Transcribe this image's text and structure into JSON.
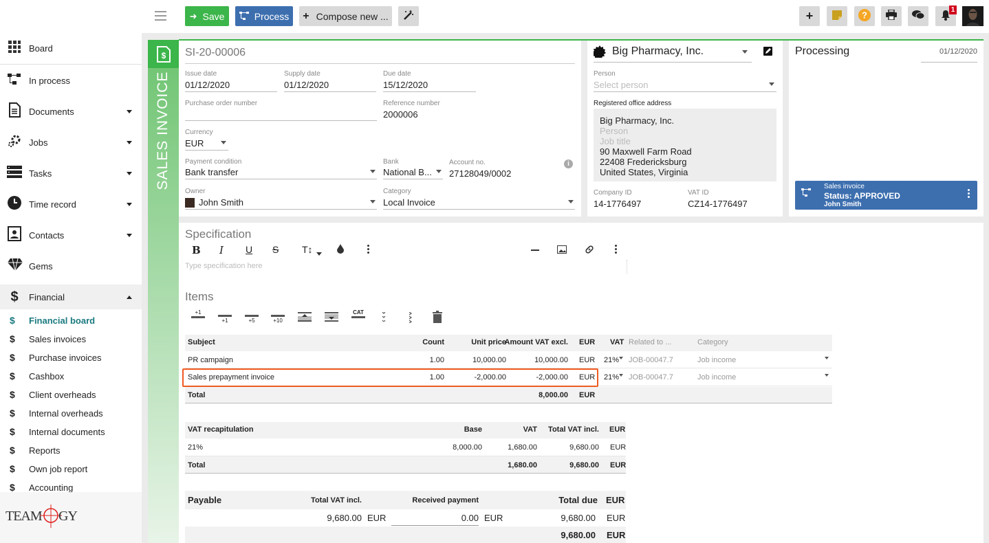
{
  "toolbar": {
    "save_label": "Save",
    "process_label": "Process",
    "compose_label": "Compose new ...",
    "notification_count": "1"
  },
  "sidebar": {
    "items": [
      {
        "label": "Board",
        "icon": "grid-icon"
      },
      {
        "label": "In process",
        "icon": "process-icon"
      },
      {
        "label": "Documents",
        "icon": "document-icon"
      },
      {
        "label": "Jobs",
        "icon": "jobs-icon"
      },
      {
        "label": "Tasks",
        "icon": "tasks-icon"
      },
      {
        "label": "Time record",
        "icon": "clock-icon"
      },
      {
        "label": "Contacts",
        "icon": "contacts-icon"
      },
      {
        "label": "Gems",
        "icon": "gem-icon"
      },
      {
        "label": "Financial",
        "icon": "dollar-icon"
      }
    ],
    "financial_sub": [
      {
        "label": "Financial board"
      },
      {
        "label": "Sales invoices"
      },
      {
        "label": "Purchase invoices"
      },
      {
        "label": "Cashbox"
      },
      {
        "label": "Client overheads"
      },
      {
        "label": "Internal overheads"
      },
      {
        "label": "Internal documents"
      },
      {
        "label": "Reports"
      },
      {
        "label": "Own job report"
      },
      {
        "label": "Accounting"
      }
    ],
    "logo_text": "TEAMOGY"
  },
  "invoice": {
    "type_label": "SALES INVOICE",
    "number": "SI-20-00006",
    "issue_date_label": "Issue date",
    "issue_date": "01/12/2020",
    "supply_date_label": "Supply date",
    "supply_date": "01/12/2020",
    "due_date_label": "Due date",
    "due_date": "15/12/2020",
    "po_label": "Purchase order number",
    "po_value": "",
    "ref_label": "Reference number",
    "ref_value": "2000006",
    "currency_label": "Currency",
    "currency": "EUR",
    "payment_label": "Payment condition",
    "payment": "Bank transfer",
    "bank_label": "Bank",
    "bank": "National B...",
    "account_label": "Account no.",
    "account": "27128049/0002",
    "owner_label": "Owner",
    "owner": "John Smith",
    "category_label": "Category",
    "category": "Local Invoice"
  },
  "client": {
    "name": "Big Pharmacy, Inc.",
    "person_label": "Person",
    "person_placeholder": "Select person",
    "address_label": "Registered office address",
    "address_name": "Big Pharmacy, Inc.",
    "address_person": "Person",
    "address_job": "Job title",
    "address_street": "90 Maxwell Farm Road",
    "address_city": "22408 Fredericksburg",
    "address_country": "United States, Virginia",
    "company_id_label": "Company ID",
    "company_id": "14-1776497",
    "vat_id_label": "VAT ID",
    "vat_id": "CZ14-1776497"
  },
  "processing": {
    "title": "Processing",
    "date": "01/12/2020",
    "card_type": "Sales invoice",
    "card_status": "Status: APPROVED",
    "card_user": "John Smith",
    "card_color": "#3d6faf"
  },
  "spec": {
    "title": "Specification",
    "placeholder": "Type specification here"
  },
  "items": {
    "title": "Items",
    "toolbar": {
      "add1": "+1",
      "add1b": "+1",
      "add5": "+5",
      "add10": "+10",
      "cat": "CAT"
    },
    "headers": {
      "subject": "Subject",
      "count": "Count",
      "unit_price": "Unit price",
      "amount": "Amount VAT excl.",
      "cur": "EUR",
      "vat": "VAT",
      "related": "Related to ...",
      "category": "Category"
    },
    "rows": [
      {
        "subject": "PR campaign",
        "count": "1.00",
        "unit_price": "10,000.00",
        "amount": "10,000.00",
        "cur": "EUR",
        "vat": "21%",
        "related": "JOB-00047.7",
        "category": "Job income"
      },
      {
        "subject": "Sales prepayment invoice",
        "count": "1.00",
        "unit_price": "-2,000.00",
        "amount": "-2,000.00",
        "cur": "EUR",
        "vat": "21%",
        "related": "JOB-00047.7",
        "category": "Job income"
      }
    ],
    "total_label": "Total",
    "total_amount": "8,000.00",
    "total_cur": "EUR",
    "highlight_color": "#f05a22"
  },
  "vat": {
    "headers": {
      "label": "VAT recapitulation",
      "base": "Base",
      "vat": "VAT",
      "total": "Total VAT incl.",
      "cur": "EUR"
    },
    "row": {
      "rate": "21%",
      "base": "8,000.00",
      "vat": "1,680.00",
      "total": "9,680.00",
      "cur": "EUR"
    },
    "total": {
      "label": "Total",
      "vat": "1,680.00",
      "total": "9,680.00",
      "cur": "EUR"
    }
  },
  "payable": {
    "label": "Payable",
    "total_incl_label": "Total VAT incl.",
    "received_label": "Received payment",
    "total_due_label": "Total due",
    "cur_label": "EUR",
    "total_incl": "9,680.00",
    "total_incl_cur": "EUR",
    "received": "0.00",
    "received_cur": "EUR",
    "total_due": "9,680.00",
    "total_due_cur": "EUR",
    "grand_total": "9,680.00",
    "grand_cur": "EUR"
  },
  "colors": {
    "green": "#3cb54a",
    "blue": "#3d6faf",
    "orange": "#f05a22",
    "accent_teal": "#1a7a80"
  }
}
